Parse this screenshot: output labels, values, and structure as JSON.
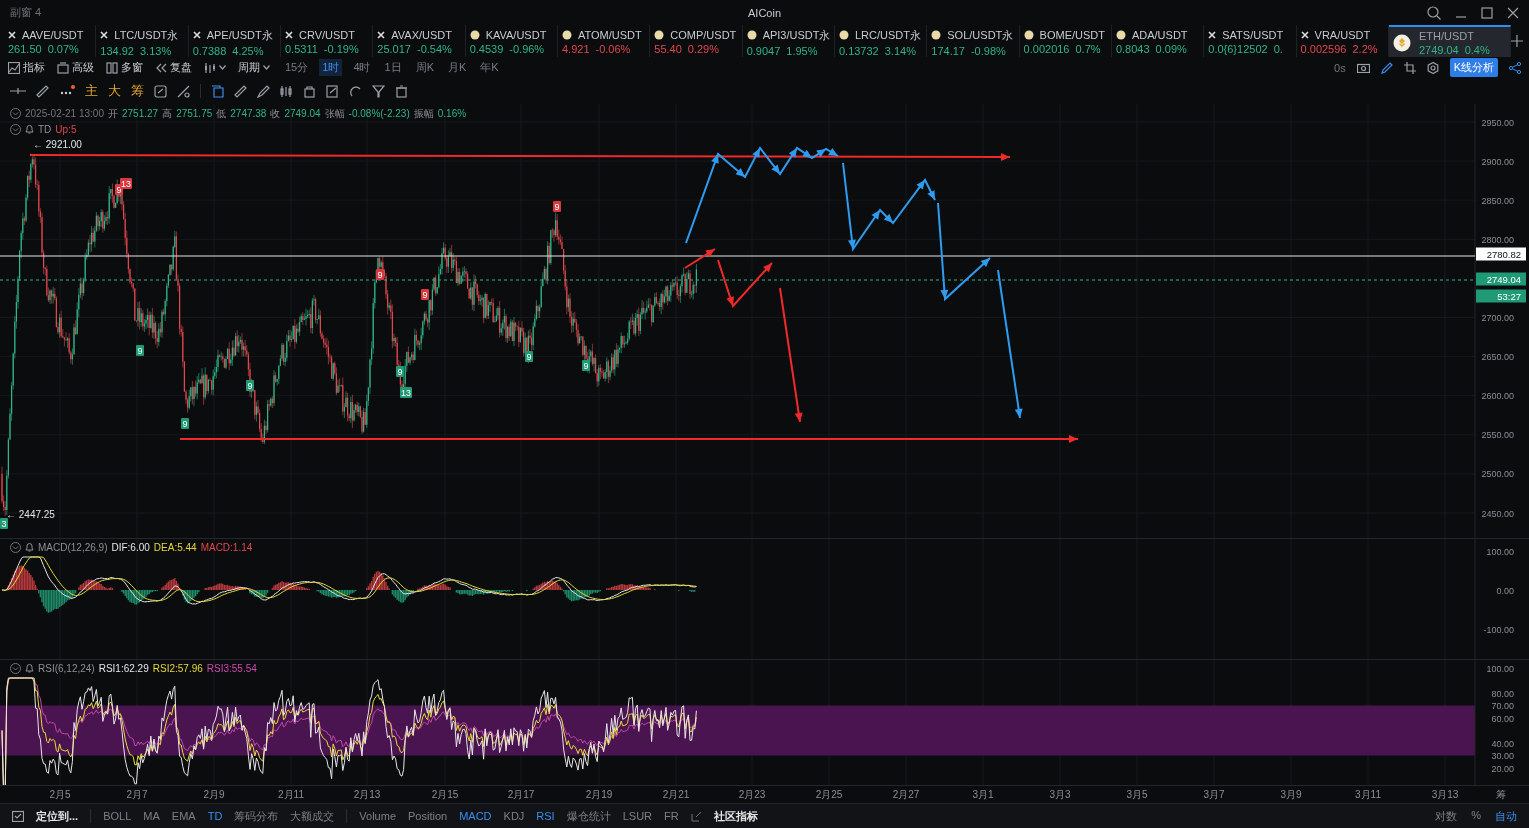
{
  "window": {
    "title": "副窗 4",
    "app": "AICoin"
  },
  "tickers": [
    {
      "symbol": "AAVE/USDT",
      "price": "261.50",
      "change": "0.07%",
      "kind": "cross",
      "color": "#2fb589",
      "selected": false
    },
    {
      "symbol": "LTC/USDT永",
      "price": "134.92",
      "change": "3.13%",
      "kind": "cross",
      "color": "#2fb589",
      "selected": false
    },
    {
      "symbol": "APE/USDT永",
      "price": "0.7388",
      "change": "4.25%",
      "kind": "cross",
      "color": "#2fb589",
      "selected": false
    },
    {
      "symbol": "CRV/USDT",
      "price": "0.5311",
      "change": "-0.19%",
      "kind": "cross",
      "color": "#2fb589",
      "selected": false
    },
    {
      "symbol": "AVAX/USDT",
      "price": "25.017",
      "change": "-0.54%",
      "kind": "cross",
      "color": "#2fb589",
      "selected": false
    },
    {
      "symbol": "KAVA/USDT",
      "price": "0.4539",
      "change": "-0.96%",
      "kind": "coin",
      "color": "#2fb589",
      "selected": false
    },
    {
      "symbol": "ATOM/USDT",
      "price": "4.921",
      "change": "-0.06%",
      "kind": "coin",
      "color": "#e0484e",
      "selected": false
    },
    {
      "symbol": "COMP/USDT",
      "price": "55.40",
      "change": "0.29%",
      "kind": "coin",
      "color": "#e0484e",
      "selected": false
    },
    {
      "symbol": "API3/USDT永",
      "price": "0.9047",
      "change": "1.95%",
      "kind": "coin",
      "color": "#2fb589",
      "selected": false
    },
    {
      "symbol": "LRC/USDT永",
      "price": "0.13732",
      "change": "3.14%",
      "kind": "coin",
      "color": "#2fb589",
      "selected": false
    },
    {
      "symbol": "SOL/USDT永",
      "price": "174.17",
      "change": "-0.98%",
      "kind": "coin",
      "color": "#2fb589",
      "selected": false
    },
    {
      "symbol": "BOME/USDT",
      "price": "0.002016",
      "change": "0.7%",
      "kind": "coin",
      "color": "#2fb589",
      "selected": false
    },
    {
      "symbol": "ADA/USDT",
      "price": "0.8043",
      "change": "0.09%",
      "kind": "coin",
      "color": "#2fb589",
      "selected": false
    },
    {
      "symbol": "SATS/USDT",
      "price": "0.0{6}12502",
      "change": "0.",
      "kind": "cross",
      "color": "#2fb589",
      "selected": false
    },
    {
      "symbol": "VRA/USDT",
      "price": "0.002596",
      "change": "2.2%",
      "kind": "cross",
      "color": "#e0484e",
      "selected": false
    },
    {
      "symbol": "ETH/USDT",
      "price": "2749.04",
      "change": "0.4%",
      "kind": "logo",
      "color": "#2fb589",
      "selected": true
    }
  ],
  "toolbar": {
    "tools": [
      "指标",
      "高级",
      "多窗",
      "复盘"
    ],
    "period": "周期",
    "intervals": [
      {
        "label": "15分",
        "selected": false
      },
      {
        "label": "1时",
        "selected": true
      },
      {
        "label": "4时",
        "selected": false
      },
      {
        "label": "1日",
        "selected": false
      },
      {
        "label": "周K",
        "selected": false
      },
      {
        "label": "月K",
        "selected": false
      },
      {
        "label": "年K",
        "selected": false
      }
    ],
    "countdown": "0s",
    "analysis_button": "K线分析"
  },
  "drawing_toolbar": {
    "glyphs": [
      "主",
      "大",
      "筹"
    ]
  },
  "main_chart": {
    "info": {
      "time": "2025-02-21 13:00",
      "fields": [
        {
          "label": "开",
          "value": "2751.27"
        },
        {
          "label": "高",
          "value": "2751.75"
        },
        {
          "label": "低",
          "value": "2747.38"
        },
        {
          "label": "收",
          "value": "2749.04"
        },
        {
          "label": "张幅",
          "value": "-0.08%(-2.23)"
        },
        {
          "label": "振幅",
          "value": "0.16%"
        }
      ]
    },
    "indicator": {
      "name": "TD",
      "value": "Up:5"
    },
    "high_marker": "← 2921.00",
    "low_marker": "← 2447.25",
    "td_marks": [
      {
        "label": "9",
        "color": "#d9383e"
      },
      {
        "label": "13",
        "color": "#d9383e"
      },
      {
        "label": "9",
        "color": "#1f9a74"
      },
      {
        "label": "9",
        "color": "#1f9a74"
      },
      {
        "label": "9",
        "color": "#1f9a74"
      },
      {
        "label": "9",
        "color": "#d9383e"
      },
      {
        "label": "9",
        "color": "#d9383e"
      },
      {
        "label": "9",
        "color": "#1f9a74"
      },
      {
        "label": "13",
        "color": "#1f9a74"
      },
      {
        "label": "9",
        "color": "#1f9a74"
      },
      {
        "label": "9",
        "color": "#d9383e"
      },
      {
        "label": "9",
        "color": "#1f9a74"
      },
      {
        "label": "3",
        "color": "#1f9a74"
      }
    ],
    "price_ticks": [
      "2950.00",
      "2900.00",
      "2850.00",
      "2800.00",
      "2700.00",
      "2650.00",
      "2600.00",
      "2550.00",
      "2500.00",
      "2450.00"
    ],
    "price_tags": [
      {
        "label": "2780.82",
        "kind": "line"
      },
      {
        "label": "2749.04",
        "kind": "last"
      },
      {
        "label": "53:27",
        "kind": "countdown"
      }
    ]
  },
  "macd": {
    "name": "MACD(12,26,9)",
    "dif": "DIF:6.00",
    "dea": "DEA:5.44",
    "macd": "MACD:1.14",
    "ticks": [
      "100.00",
      "0.00",
      "-100.00"
    ]
  },
  "rsi": {
    "name": "RSI(6,12,24)",
    "rsi1": "RSI1:62.29",
    "rsi2": "RSI2:57.96",
    "rsi3": "RSI3:55.54",
    "ticks": [
      "100.00",
      "80.00",
      "70.00",
      "60.00",
      "40.00",
      "30.00",
      "20.00"
    ]
  },
  "dates": [
    "2月5",
    "2月7",
    "2月9",
    "2月11",
    "2月13",
    "2月15",
    "2月17",
    "2月19",
    "2月21",
    "2月23",
    "2月25",
    "2月27",
    "3月1",
    "3月3",
    "3月5",
    "3月7",
    "3月9",
    "3月11",
    "3月13"
  ],
  "date_axis_glyph": "筹",
  "bottom_bar": {
    "locate": "定位到...",
    "main_indicators": [
      {
        "label": "BOLL",
        "selected": false
      },
      {
        "label": "MA",
        "selected": false
      },
      {
        "label": "EMA",
        "selected": false
      },
      {
        "label": "TD",
        "selected": true
      },
      {
        "label": "筹码分布",
        "selected": false
      },
      {
        "label": "大额成交",
        "selected": false
      }
    ],
    "sub_indicators": [
      {
        "label": "Volume",
        "selected": false
      },
      {
        "label": "Position",
        "selected": false
      },
      {
        "label": "MACD",
        "selected": true
      },
      {
        "label": "KDJ",
        "selected": false
      },
      {
        "label": "RSI",
        "selected": true
      },
      {
        "label": "爆仓统计",
        "selected": false
      },
      {
        "label": "LSUR",
        "selected": false
      },
      {
        "label": "FR",
        "selected": false
      }
    ],
    "community": "社区指标",
    "scale_options": [
      {
        "label": "对数",
        "selected": false
      },
      {
        "label": "%",
        "selected": false
      },
      {
        "label": "自动",
        "selected": true
      }
    ]
  }
}
